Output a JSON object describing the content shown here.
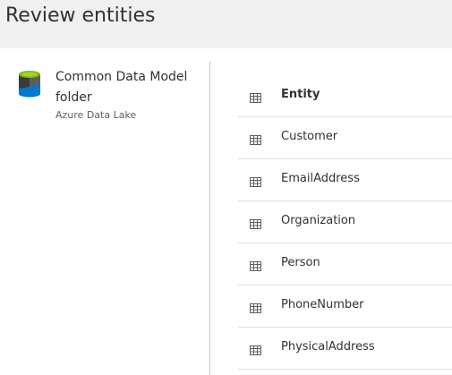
{
  "header": {
    "title": "Review entities"
  },
  "source": {
    "icon": "data-lake-cylinder-icon",
    "name": "Common Data Model folder",
    "subtitle": "Azure Data Lake"
  },
  "entities": {
    "header_label": "Entity",
    "row_icon": "table-icon",
    "rows": [
      {
        "label": "Customer"
      },
      {
        "label": "EmailAddress"
      },
      {
        "label": "Organization"
      },
      {
        "label": "Person"
      },
      {
        "label": "PhoneNumber"
      },
      {
        "label": "PhysicalAddress"
      }
    ]
  },
  "colors": {
    "header_bg": "#f0f0f0",
    "divider": "#c8c6c4",
    "row_border": "#e1dfdd",
    "icon_green": "#7fba00",
    "icon_dark": "#3b3a39",
    "icon_blue": "#0078d4"
  }
}
